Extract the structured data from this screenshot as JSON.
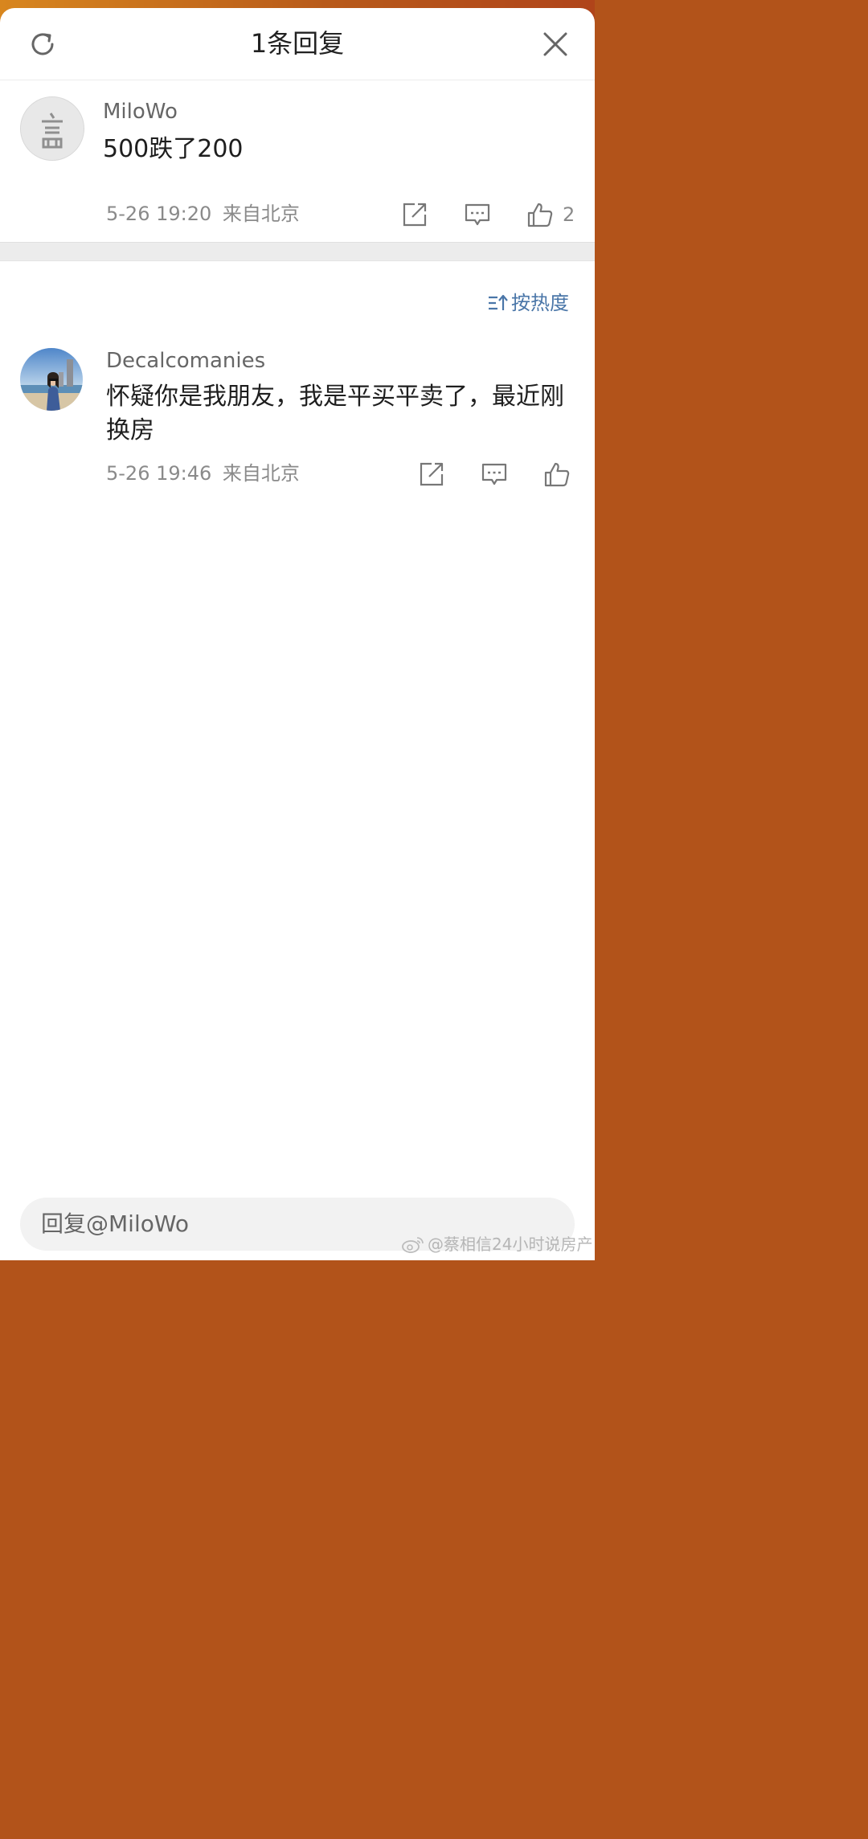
{
  "header": {
    "title": "1条回复",
    "refresh_icon": "refresh-icon",
    "close_icon": "close-icon"
  },
  "main_comment": {
    "username": "MiloWo",
    "content": "500跌了200",
    "time": "5-26 19:20",
    "location": "来自北京",
    "like_count": "2"
  },
  "sort": {
    "label": "按热度",
    "icon": "sort-icon"
  },
  "replies": [
    {
      "username": "Decalcomanies",
      "content": "怀疑你是我朋友，我是平买平卖了，最近刚换房",
      "time": "5-26 19:46",
      "location": "来自北京"
    }
  ],
  "reply_input": {
    "placeholder": "回复@MiloWo"
  },
  "watermark": {
    "text": "@蔡相信24小时说房产"
  },
  "colors": {
    "accent_link": "#4a76a8",
    "meta_gray": "#8a8a8a",
    "top_band": "#c0641a"
  }
}
